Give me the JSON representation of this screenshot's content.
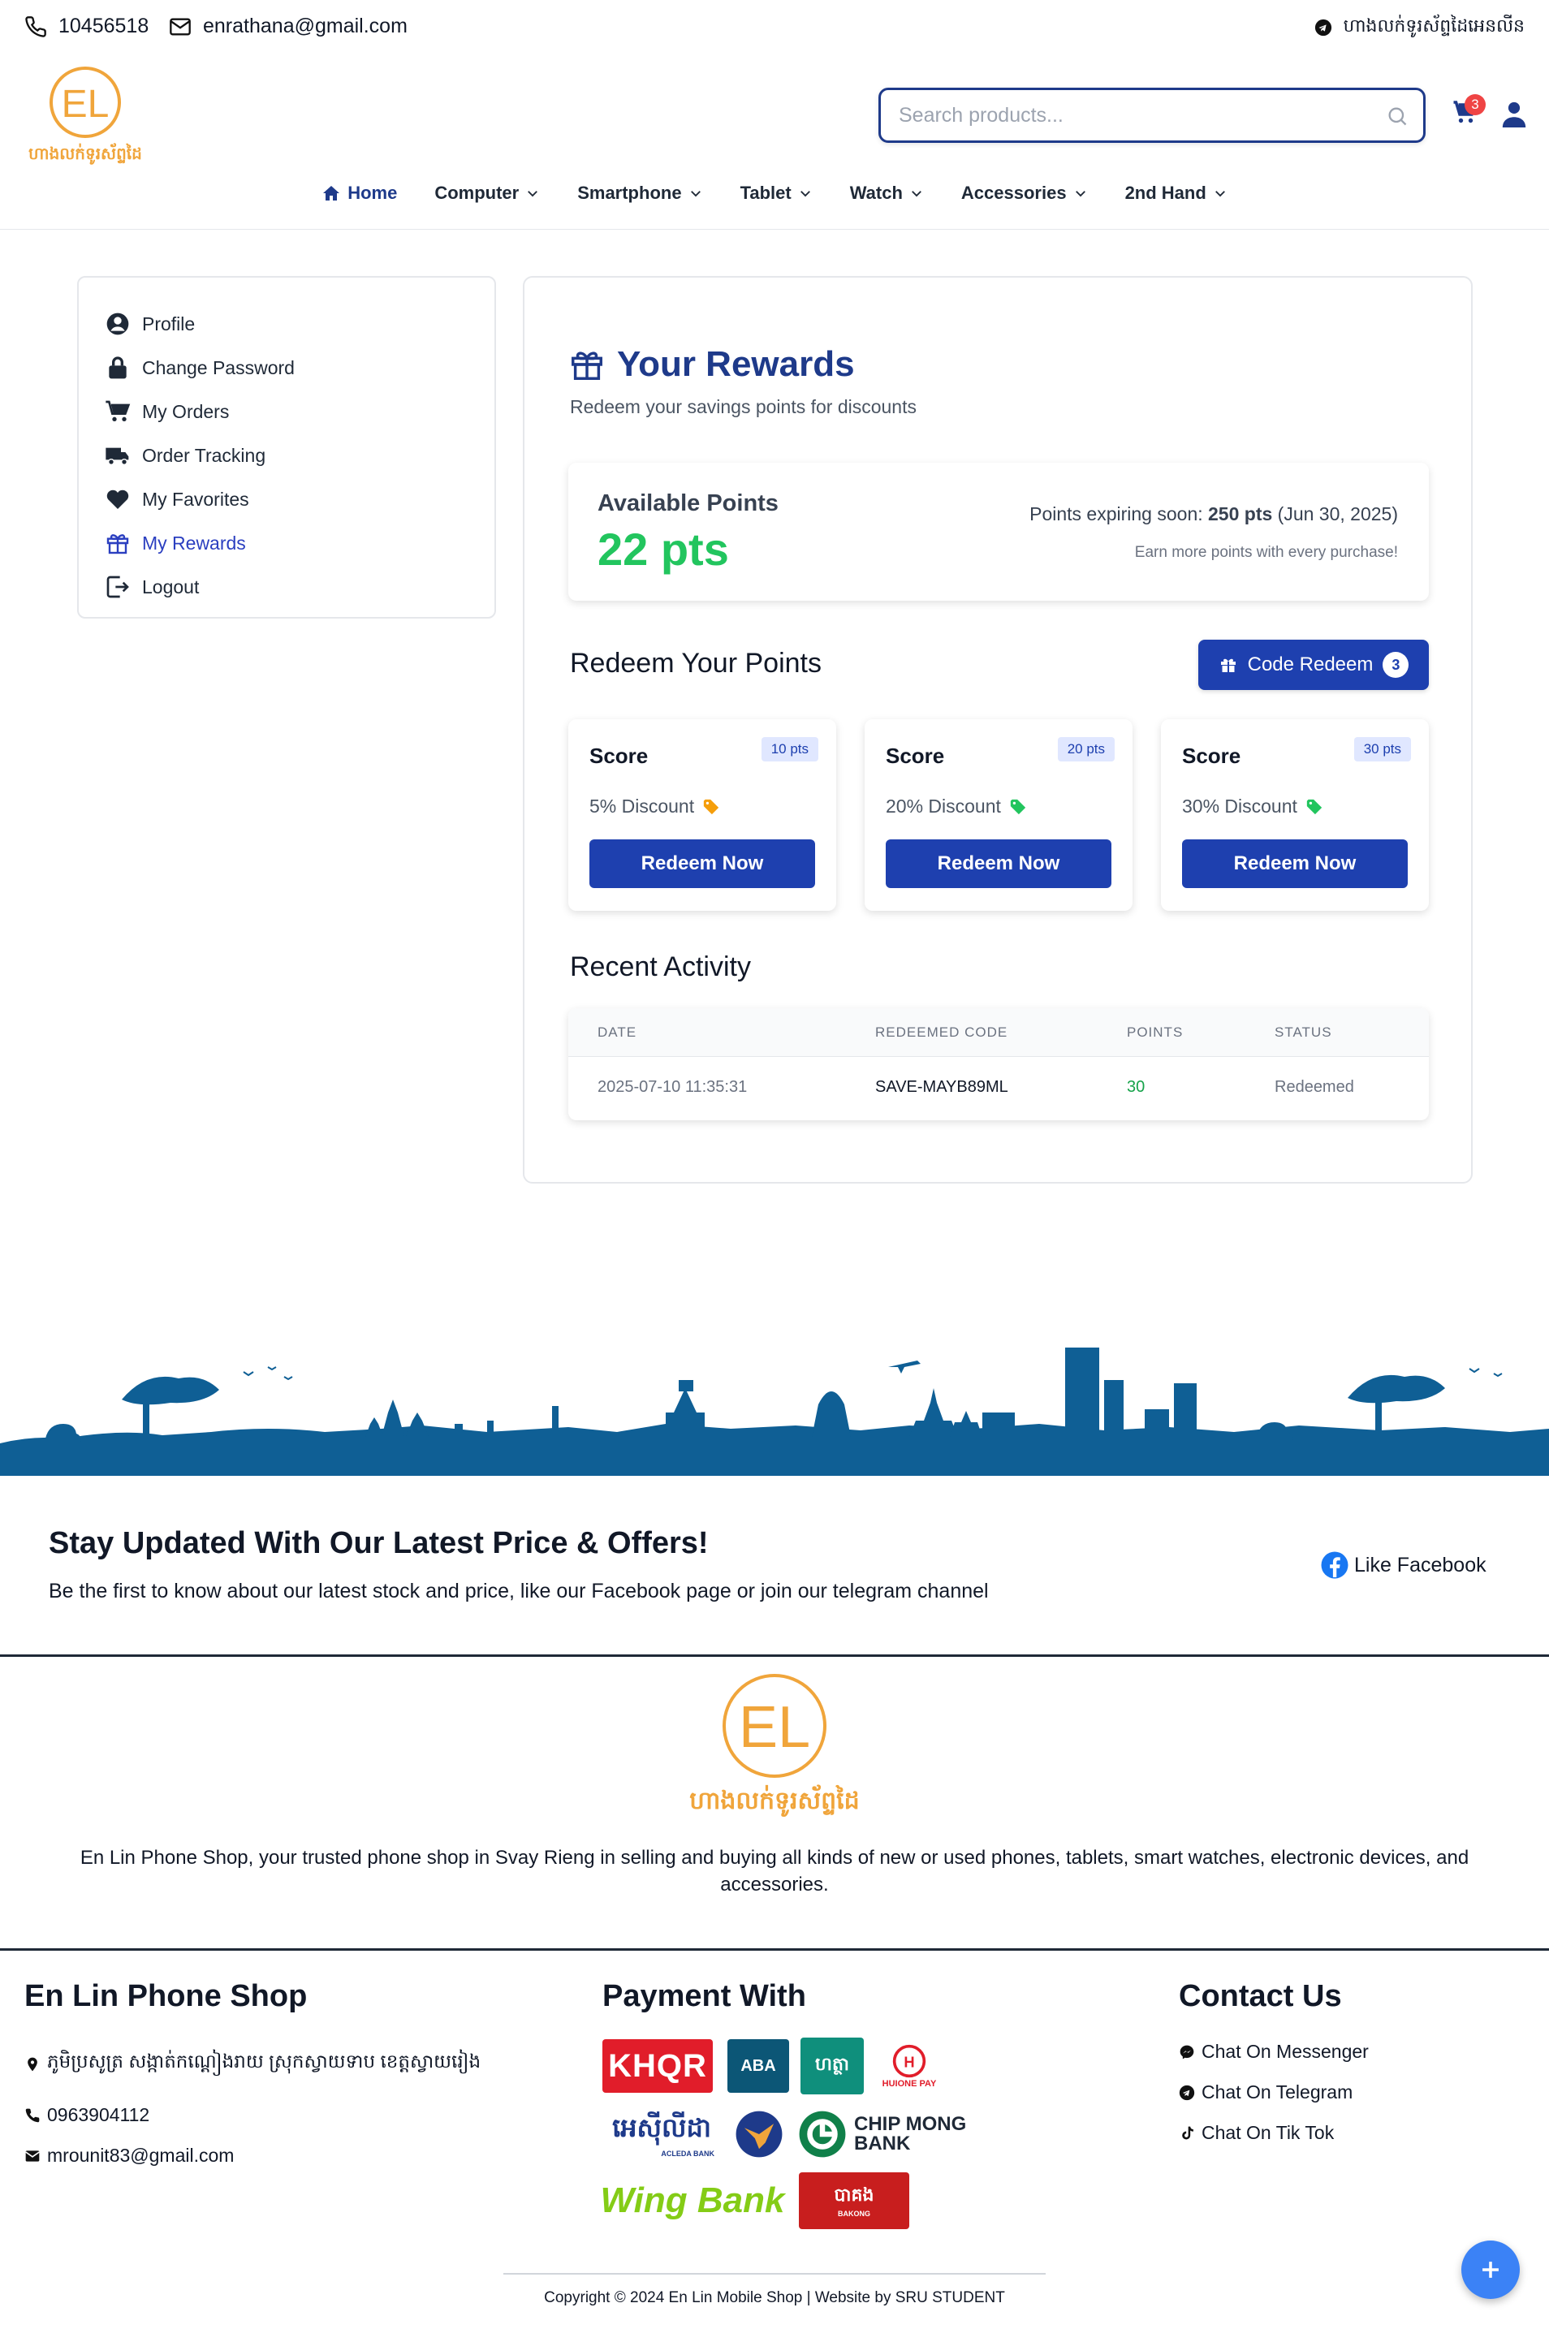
{
  "topbar": {
    "phone": "10456518",
    "email": "enrathana@gmail.com",
    "shop_name_kh": "ហាងលក់ទូរស័ព្ទដៃអេនលីន"
  },
  "logo": {
    "letters": "EL",
    "name_kh": "ហាងលក់ទូរស័ព្ទដៃ"
  },
  "search": {
    "placeholder": "Search products..."
  },
  "cart": {
    "count": "3"
  },
  "nav": {
    "items": [
      {
        "label": "Home",
        "icon": "home-icon"
      },
      {
        "label": "Computer",
        "icon": "chevron-down-icon"
      },
      {
        "label": "Smartphone",
        "icon": "chevron-down-icon"
      },
      {
        "label": "Tablet",
        "icon": "chevron-down-icon"
      },
      {
        "label": "Watch",
        "icon": "chevron-down-icon"
      },
      {
        "label": "Accessories",
        "icon": "chevron-down-icon"
      },
      {
        "label": "2nd Hand",
        "icon": "chevron-down-icon"
      }
    ]
  },
  "sidebar": {
    "items": [
      {
        "label": "Profile",
        "icon": "user-circle-icon"
      },
      {
        "label": "Change Password",
        "icon": "lock-icon"
      },
      {
        "label": "My Orders",
        "icon": "cart-icon"
      },
      {
        "label": "Order Tracking",
        "icon": "truck-icon"
      },
      {
        "label": "My Favorites",
        "icon": "heart-icon"
      },
      {
        "label": "My Rewards",
        "icon": "gift-icon"
      },
      {
        "label": "Logout",
        "icon": "logout-icon"
      }
    ]
  },
  "rewards": {
    "title": "Your Rewards",
    "subtitle": "Redeem your savings points for discounts",
    "available_label": "Available Points",
    "available_value": "22 pts",
    "expiring_prefix": "Points expiring soon: ",
    "expiring_points": "250 pts",
    "expiring_date": " (Jun 30, 2025)",
    "earn_note": "Earn more points with every purchase!"
  },
  "redeem": {
    "title": "Redeem Your Points",
    "code_button": "Code Redeem",
    "code_count": "3",
    "cards": [
      {
        "title": "Score",
        "points": "10 pts",
        "discount": "5% Discount",
        "tag_color": "#f59e0b",
        "button": "Redeem Now"
      },
      {
        "title": "Score",
        "points": "20 pts",
        "discount": "20% Discount",
        "tag_color": "#22c55e",
        "button": "Redeem Now"
      },
      {
        "title": "Score",
        "points": "30 pts",
        "discount": "30% Discount",
        "tag_color": "#22c55e",
        "button": "Redeem Now"
      }
    ]
  },
  "activity": {
    "title": "Recent Activity",
    "headers": [
      "DATE",
      "REDEEMED CODE",
      "POINTS",
      "STATUS"
    ],
    "rows": [
      [
        "2025-07-10 11:35:31",
        "SAVE-MAYB89ML",
        "30",
        "Redeemed"
      ]
    ]
  },
  "newsletter": {
    "title": "Stay Updated With Our Latest Price & Offers!",
    "subtitle": "Be the first to know about our latest stock and price, like our Facebook page or join our telegram channel",
    "facebook": "Like Facebook"
  },
  "about": "En Lin Phone Shop, your trusted phone shop in Svay Rieng in selling and buying all kinds of new or used phones, tablets, smart watches, electronic devices, and accessories.",
  "footer": {
    "shop": {
      "title": "En Lin Phone Shop",
      "address": "ភូមិប្រសូត្រ សង្កាត់កណ្តៀងរាយ ស្រុកស្វាយទាប ខេត្តស្វាយរៀង",
      "phone": "0963904112",
      "email": "mrounit83@gmail.com"
    },
    "payment": {
      "title": "Payment With",
      "logos": [
        "KHQR",
        "ABA",
        "ហត្ថា",
        "HUIONE PAY",
        "អេស៊ីលីដា",
        "ACLEDA BANK",
        "CHIP MONG BANK",
        "Wing Bank",
        "បាគង",
        "BAKONG"
      ]
    },
    "contact": {
      "title": "Contact Us",
      "items": [
        "Chat On Messenger",
        "Chat On Telegram",
        "Chat On Tik Tok"
      ]
    },
    "copyright": "Copyright © 2024 En Lin Mobile Shop | Website by SRU STUDENT"
  },
  "colors": {
    "primary": "#1e40af",
    "brand_orange": "#f0a53b",
    "points_green": "#22c55e",
    "skyline_blue": "#0f5f95"
  }
}
